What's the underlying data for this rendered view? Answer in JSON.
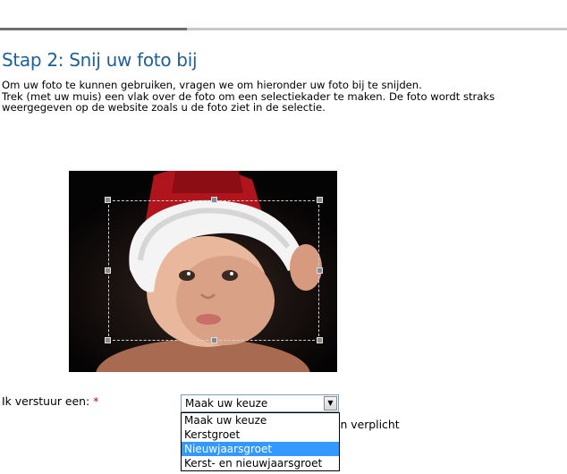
{
  "step": {
    "title": "Stap 2: Snij uw foto bij",
    "intro_lines": [
      "Om uw foto te kunnen gebruiken, vragen we om hieronder uw foto bij te snijden.",
      "Trek (met uw muis) een vlak over de foto om een selectiekader te maken. De foto wordt straks",
      "weergegeven op de website zoals u de foto ziet in de selectie."
    ],
    "progress_fraction": 0.33
  },
  "form": {
    "label": "Ik verstuur een:",
    "required_marker": "*",
    "select": {
      "value": "Maak uw keuze",
      "options": [
        "Maak uw keuze",
        "Kerstgroet",
        "Nieuwjaarsgroet",
        "Kerst- en nieuwjaarsgroet"
      ],
      "highlighted_option": "Nieuwjaarsgroet"
    },
    "partial_hidden_text": "jn verplicht"
  },
  "colors": {
    "title": "#1f5f96",
    "required": "#d00000",
    "highlight": "#3399ff"
  }
}
